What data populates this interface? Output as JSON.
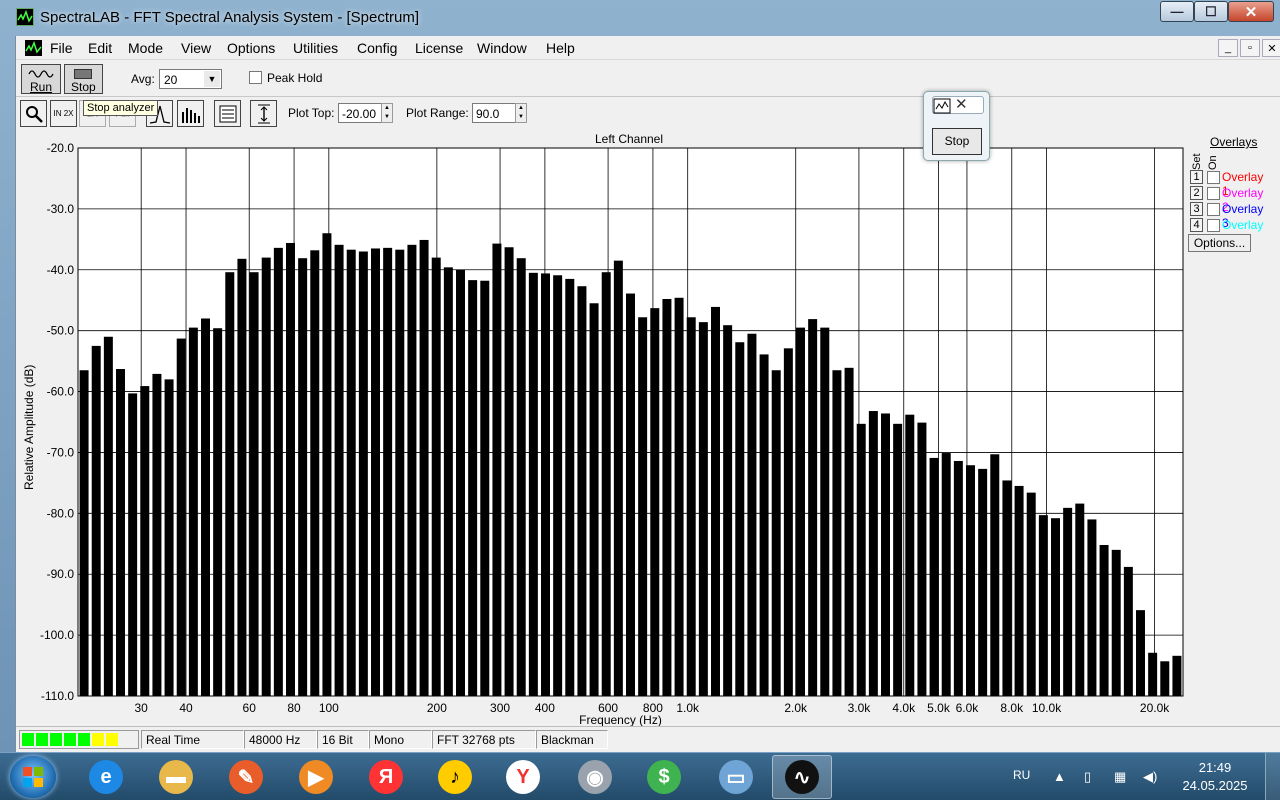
{
  "window": {
    "title": "SpectraLAB - FFT Spectral Analysis System - [Spectrum]",
    "buttons": {
      "minimize": "—",
      "maximize": "☐",
      "close": "✕"
    }
  },
  "menu": {
    "items": [
      "File",
      "Edit",
      "Mode",
      "View",
      "Options",
      "Utilities",
      "Config",
      "License",
      "Window",
      "Help"
    ],
    "mdi_buttons": [
      "_",
      "▫",
      "✕"
    ]
  },
  "toolbar": {
    "run_label": "Run",
    "stop_label": "Stop",
    "avg_label": "Avg:",
    "avg_value": "20",
    "peak_hold_label": "Peak Hold",
    "plot_top_label": "Plot Top:",
    "plot_top_value": "-20.00",
    "plot_range_label": "Plot Range:",
    "plot_range_value": "90.0",
    "tooltip": "Stop analyzer",
    "icon_buttons": [
      {
        "name": "zoom-icon",
        "glyph": "🔍"
      },
      {
        "name": "zoom-in-2x-icon",
        "glyph": "IN 2X"
      },
      {
        "name": "zoom-out-2x-icon",
        "glyph": "2X"
      },
      {
        "name": "zoom-full-icon",
        "glyph": "Full"
      },
      {
        "name": "peak-icon",
        "glyph": "⋀"
      },
      {
        "name": "bar-graph-icon",
        "glyph": "▮▮"
      },
      {
        "name": "table-icon",
        "glyph": "▤"
      },
      {
        "name": "autoscale-icon",
        "glyph": "↕"
      }
    ]
  },
  "float_widget": {
    "stop_label": "Stop"
  },
  "chart_data": {
    "type": "bar",
    "title": "Left Channel",
    "xlabel": "Frequency (Hz)",
    "ylabel": "Relative Amplitude (dB)",
    "xscale": "log",
    "xlim": [
      20,
      24000
    ],
    "ylim": [
      -110,
      -20
    ],
    "grid": true,
    "y_ticks": [
      "-20.0",
      "-30.0",
      "-40.0",
      "-50.0",
      "-60.0",
      "-70.0",
      "-80.0",
      "-90.0",
      "-100.0",
      "-110.0"
    ],
    "x_ticks": [
      {
        "v": 30,
        "label": "30"
      },
      {
        "v": 40,
        "label": "40"
      },
      {
        "v": 60,
        "label": "60"
      },
      {
        "v": 80,
        "label": "80"
      },
      {
        "v": 100,
        "label": "100"
      },
      {
        "v": 200,
        "label": "200"
      },
      {
        "v": 300,
        "label": "300"
      },
      {
        "v": 400,
        "label": "400"
      },
      {
        "v": 600,
        "label": "600"
      },
      {
        "v": 800,
        "label": "800"
      },
      {
        "v": 1000,
        "label": "1.0k"
      },
      {
        "v": 2000,
        "label": "2.0k"
      },
      {
        "v": 3000,
        "label": "3.0k"
      },
      {
        "v": 4000,
        "label": "4.0k"
      },
      {
        "v": 5000,
        "label": "5.0k"
      },
      {
        "v": 6000,
        "label": "6.0k"
      },
      {
        "v": 8000,
        "label": "8.0k"
      },
      {
        "v": 10000,
        "label": "10.0k"
      },
      {
        "v": 20000,
        "label": "20.0k"
      }
    ],
    "values": [
      -56.5,
      -52.5,
      -51,
      -56.3,
      -60.3,
      -59.1,
      -57.1,
      -58,
      -51.3,
      -49.5,
      -48,
      -49.6,
      -40.4,
      -38.2,
      -40.4,
      -38,
      -36.4,
      -35.6,
      -38.1,
      -36.8,
      -34,
      -35.9,
      -36.7,
      -37,
      -36.5,
      -36.4,
      -36.7,
      -35.9,
      -35.1,
      -38,
      -39.6,
      -40,
      -41.7,
      -41.8,
      -35.7,
      -36.3,
      -38.1,
      -40.5,
      -40.6,
      -40.9,
      -41.5,
      -42.7,
      -45.5,
      -40.4,
      -38.5,
      -43.9,
      -47.8,
      -46.3,
      -44.8,
      -44.6,
      -47.8,
      -48.6,
      -46.1,
      -49.1,
      -51.9,
      -50.5,
      -53.9,
      -56.5,
      -52.9,
      -49.5,
      -48.1,
      -49.5,
      -56.5,
      -56.1,
      -65.3,
      -63.2,
      -63.6,
      -65.3,
      -63.8,
      -65.1,
      -70.9,
      -70.1,
      -71.4,
      -72.1,
      -72.7,
      -70.3,
      -74.6,
      -75.5,
      -76.6,
      -80.3,
      -80.8,
      -79.1,
      -78.4,
      -81,
      -85.2,
      -86,
      -88.8,
      -95.9,
      -102.9,
      -104.3,
      -103.4
    ],
    "bar_color": "#000000"
  },
  "overlays": {
    "title": "Overlays",
    "set_label": "Set",
    "on_label": "On",
    "items": [
      {
        "num": "1",
        "name": "Overlay 1",
        "color": "#ff0000"
      },
      {
        "num": "2",
        "name": "Overlay 2",
        "color": "#ff00ff"
      },
      {
        "num": "3",
        "name": "Overlay 3",
        "color": "#0000ff"
      },
      {
        "num": "4",
        "name": "Overlay 4",
        "color": "#00ffff"
      }
    ],
    "options_label": "Options..."
  },
  "status": {
    "mode": "Real Time",
    "rate": "48000 Hz",
    "bits": "16 Bit",
    "channels": "Mono",
    "fft": "FFT 32768 pts",
    "window": "Blackman",
    "meter_colors": [
      "#00ff00",
      "#00ff00",
      "#00ff00",
      "#00ff00",
      "#00ff00",
      "#ffff00",
      "#ffff00"
    ]
  },
  "taskbar": {
    "apps": [
      {
        "name": "internet-explorer-icon",
        "glyph": "e",
        "color": "#1e88e5"
      },
      {
        "name": "file-explorer-icon",
        "glyph": "▬",
        "color": "#e8b84a"
      },
      {
        "name": "app-gift-icon",
        "glyph": "✎",
        "color": "#e85d2a"
      },
      {
        "name": "media-player-icon",
        "glyph": "▶",
        "color": "#f08a24"
      },
      {
        "name": "yandex-icon",
        "glyph": "Я",
        "color": "#f33"
      },
      {
        "name": "yandex-music-icon",
        "glyph": "♪",
        "color": "#ffcc00"
      },
      {
        "name": "yandex-browser-icon",
        "glyph": "Y",
        "color": "#ffffff"
      },
      {
        "name": "speaker-app-icon",
        "glyph": "◉",
        "color": "#9aa3ad"
      },
      {
        "name": "money-app-icon",
        "glyph": "$",
        "color": "#3fb34f"
      },
      {
        "name": "network-computer-icon",
        "glyph": "▭",
        "color": "#6fa5d6"
      },
      {
        "name": "spectralab-icon",
        "glyph": "∿",
        "color": "#111111"
      }
    ],
    "lang": "RU",
    "time": "21:49",
    "date": "24.05.2025"
  }
}
